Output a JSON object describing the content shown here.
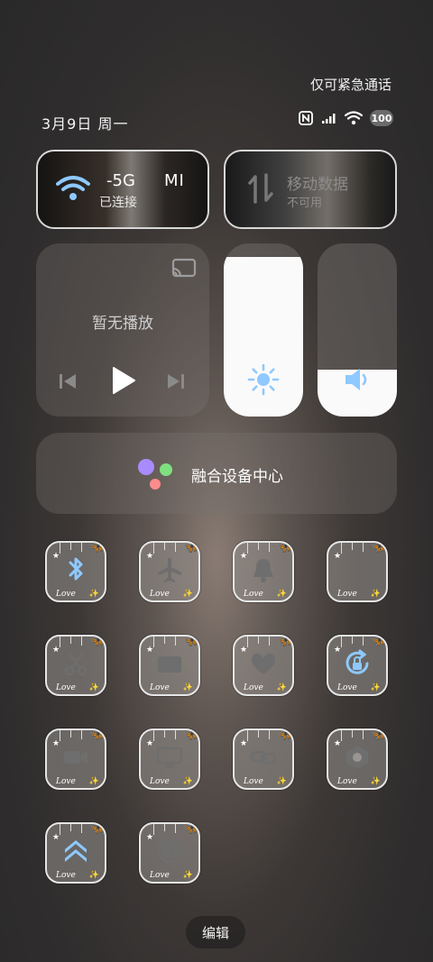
{
  "status": {
    "emergency_text": "仅可紧急通话",
    "date_text": "3月9日 周一",
    "battery_level": "100"
  },
  "wifi_card": {
    "ssid_visible": "-5G",
    "extra_text": "MI",
    "status": "已连接"
  },
  "data_card": {
    "title": "移动数据",
    "status": "不可用"
  },
  "media": {
    "now_playing": "暂无播放"
  },
  "sliders": {
    "brightness_level": 0.92,
    "volume_level": 0.27
  },
  "device_center": {
    "label": "融合设备中心"
  },
  "tiles": {
    "deco_text": "Love"
  },
  "footer": {
    "edit_label": "编辑"
  },
  "colors": {
    "accent_blue": "#8ec9ff",
    "icon_gray": "#6e6e6e",
    "slider_fill": "#fafafa"
  }
}
